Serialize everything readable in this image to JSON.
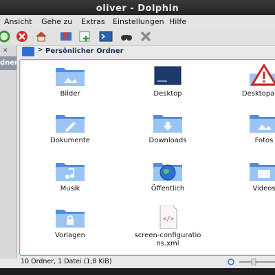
{
  "window": {
    "title": "oliver - Dolphin"
  },
  "menu": [
    {
      "label": "Ansicht"
    },
    {
      "label": "Gehe zu"
    },
    {
      "label": "Extras"
    },
    {
      "label": "Einstellungen"
    },
    {
      "label": "Hilfe"
    }
  ],
  "sidebar": {
    "selected_label": "dner"
  },
  "breadcrumb": {
    "label": "Persönlicher Ordner"
  },
  "items": [
    {
      "label": "Bilder"
    },
    {
      "label": "Desktop"
    },
    {
      "label": "Desktopauss"
    },
    {
      "label": "Dokumente"
    },
    {
      "label": "Downloads"
    },
    {
      "label": "Fotos"
    },
    {
      "label": "Musik"
    },
    {
      "label": "Öffentlich"
    },
    {
      "label": "Videos"
    },
    {
      "label": "Vorlagen"
    },
    {
      "label": "screen-configurations.xml"
    }
  ],
  "status": {
    "text": "10 Ordner, 1 Datei (1,8 KiB)"
  },
  "colors": {
    "folder": "#4f8fdc",
    "folder_light": "#9cc4f2",
    "accent": "#2e6fd1"
  }
}
